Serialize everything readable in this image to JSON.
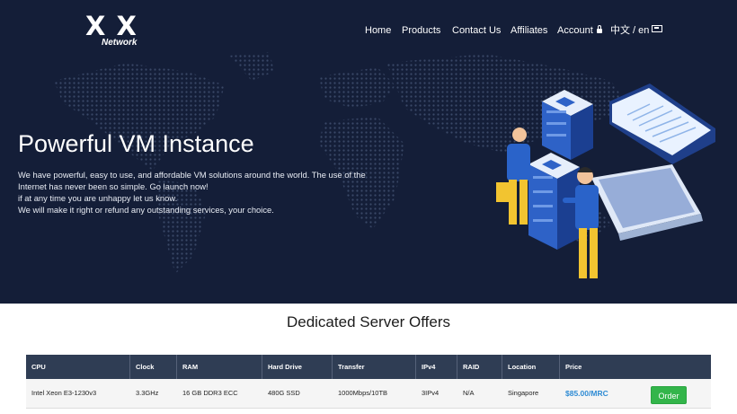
{
  "brand": {
    "logo_text": "X X",
    "logo_sub": "Network"
  },
  "nav": {
    "home": "Home",
    "products": "Products",
    "contact": "Contact Us",
    "affiliates": "Affiliates",
    "account": "Account",
    "language": "中文 / en"
  },
  "hero": {
    "title": "Powerful VM Instance",
    "lines": [
      "We have powerful, easy to use, and affordable VM solutions around the world. The use of the",
      "Internet has never been so simple. Go launch now!",
      "if at any time you are unhappy let us know.",
      "We will make it right or refund any outstanding services, your choice."
    ]
  },
  "offers": {
    "title": "Dedicated Server Offers",
    "headers": [
      "CPU",
      "Clock",
      "RAM",
      "Hard Drive",
      "Transfer",
      "IPv4",
      "RAID",
      "Location",
      "Price"
    ],
    "rows": [
      {
        "cpu": "Intel Xeon E3-1230v3",
        "clock": "3.3GHz",
        "ram": "16 GB DDR3 ECC",
        "drive": "480G SSD",
        "transfer": "1000Mbps/10TB",
        "ipv4": "3IPv4",
        "raid": "N/A",
        "location": "Singapore",
        "price": "$85.00/MRC",
        "order_label": "Order"
      }
    ]
  },
  "colors": {
    "hero_bg": "#141e38",
    "table_header": "#2f3d54",
    "price": "#2e8bd4",
    "order_button": "#33b54a"
  },
  "icons": [
    "lock-icon",
    "flag-icon",
    "world-map",
    "server-laptop-illustration"
  ]
}
